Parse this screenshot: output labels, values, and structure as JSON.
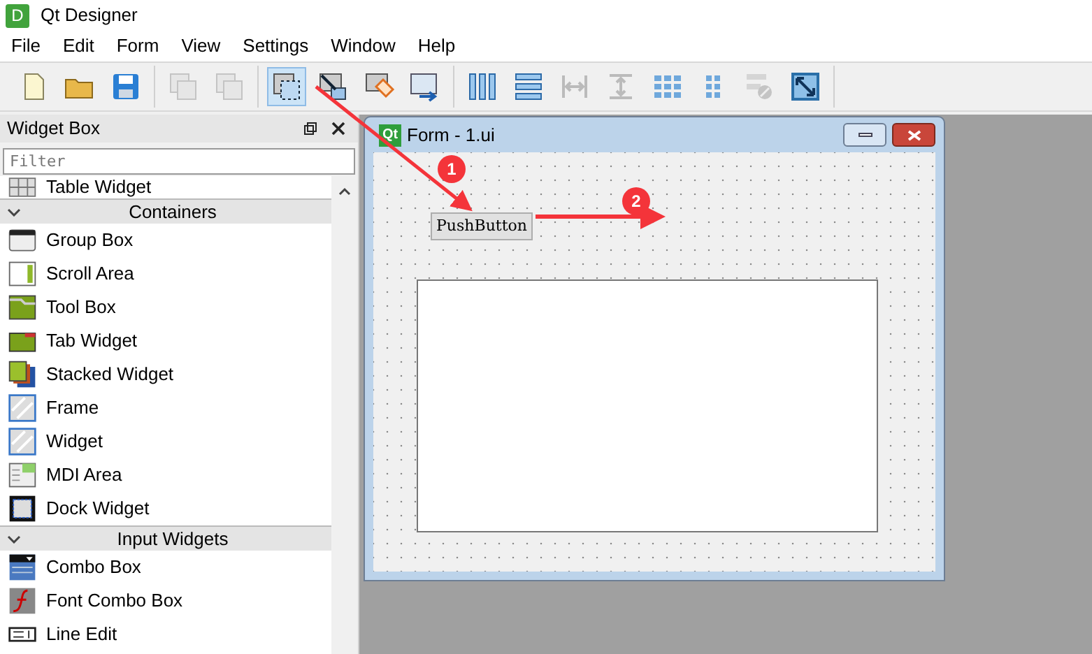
{
  "app": {
    "icon_letter": "D",
    "title": "Qt Designer"
  },
  "menu": [
    "File",
    "Edit",
    "Form",
    "View",
    "Settings",
    "Window",
    "Help"
  ],
  "toolbar": {
    "groups": [
      [
        {
          "kind": "new",
          "selected": false,
          "disabled": false
        },
        {
          "kind": "open",
          "selected": false,
          "disabled": false
        },
        {
          "kind": "save",
          "selected": false,
          "disabled": false
        }
      ],
      [
        {
          "kind": "copy",
          "selected": false,
          "disabled": true
        },
        {
          "kind": "paste",
          "selected": false,
          "disabled": true
        }
      ],
      [
        {
          "kind": "edit_widgets",
          "selected": true,
          "disabled": false
        },
        {
          "kind": "edit_signals",
          "selected": false,
          "disabled": false
        },
        {
          "kind": "edit_buddies",
          "selected": false,
          "disabled": false
        },
        {
          "kind": "edit_tab_order",
          "selected": false,
          "disabled": false
        }
      ],
      [
        {
          "kind": "layout_h",
          "selected": false,
          "disabled": false
        },
        {
          "kind": "layout_v",
          "selected": false,
          "disabled": false
        },
        {
          "kind": "splitter_h",
          "selected": false,
          "disabled": true
        },
        {
          "kind": "splitter_v",
          "selected": false,
          "disabled": true
        },
        {
          "kind": "grid",
          "selected": false,
          "disabled": false
        },
        {
          "kind": "form_layout",
          "selected": false,
          "disabled": false
        },
        {
          "kind": "break_layout",
          "selected": false,
          "disabled": true
        },
        {
          "kind": "adjust_size",
          "selected": false,
          "disabled": false
        }
      ]
    ]
  },
  "widget_box": {
    "title": "Widget Box",
    "filter": {
      "placeholder": "Filter"
    },
    "sections": [
      {
        "items": [
          {
            "kind": "table",
            "label": "Table Widget"
          }
        ]
      },
      {
        "label": "Containers",
        "expanded": true,
        "items": [
          {
            "kind": "group_box",
            "label": "Group Box"
          },
          {
            "kind": "scroll_area",
            "label": "Scroll Area"
          },
          {
            "kind": "tool_box",
            "label": "Tool Box"
          },
          {
            "kind": "tab_widget",
            "label": "Tab Widget"
          },
          {
            "kind": "stacked",
            "label": "Stacked Widget"
          },
          {
            "kind": "frame",
            "label": "Frame"
          },
          {
            "kind": "widget",
            "label": "Widget"
          },
          {
            "kind": "mdi",
            "label": "MDI Area"
          },
          {
            "kind": "dock",
            "label": "Dock Widget"
          }
        ]
      },
      {
        "label": "Input Widgets",
        "expanded": true,
        "items": [
          {
            "kind": "combo",
            "label": "Combo Box"
          },
          {
            "kind": "font_combo",
            "label": "Font Combo Box"
          },
          {
            "kind": "line_edit",
            "label": "Line Edit"
          }
        ]
      }
    ]
  },
  "form": {
    "icon_text": "Qt",
    "title": "Form - 1.ui",
    "widgets": [
      {
        "kind": "push_button",
        "text": "PushButton"
      },
      {
        "kind": "frame"
      }
    ]
  },
  "annotations": [
    {
      "label": "1"
    },
    {
      "label": "2"
    }
  ]
}
